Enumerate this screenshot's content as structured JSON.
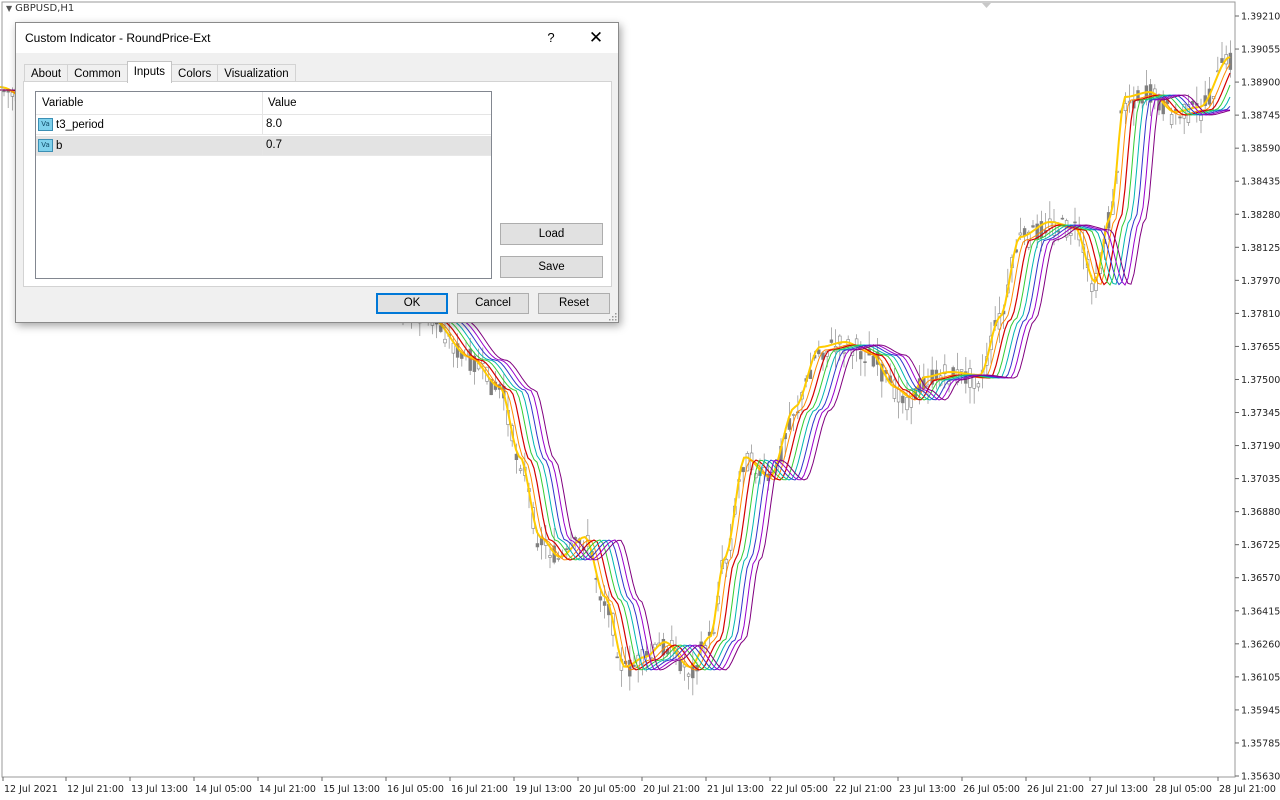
{
  "chart": {
    "symbol_label": "GBPUSD,H1",
    "y_labels": [
      "1.39210",
      "1.39055",
      "1.38900",
      "1.38745",
      "1.38590",
      "1.38435",
      "1.38280",
      "1.38125",
      "1.37970",
      "1.37810",
      "1.37655",
      "1.37500",
      "1.37345",
      "1.37190",
      "1.37035",
      "1.36880",
      "1.36725",
      "1.36570",
      "1.36415",
      "1.36260",
      "1.36105",
      "1.35945",
      "1.35785",
      "1.35630"
    ],
    "x_labels": [
      "12 Jul 2021",
      "12 Jul 21:00",
      "13 Jul 13:00",
      "14 Jul 05:00",
      "14 Jul 21:00",
      "15 Jul 13:00",
      "16 Jul 05:00",
      "16 Jul 21:00",
      "19 Jul 13:00",
      "20 Jul 05:00",
      "20 Jul 21:00",
      "21 Jul 13:00",
      "22 Jul 05:00",
      "22 Jul 21:00",
      "23 Jul 13:00",
      "26 Jul 05:00",
      "26 Jul 21:00",
      "27 Jul 13:00",
      "28 Jul 05:00",
      "28 Jul 21:00"
    ],
    "colors": {
      "candle": "#7f7f7f",
      "bands": [
        "#ffcc00",
        "#ff8c00",
        "#d40000",
        "#33cc33",
        "#00b3b3",
        "#3333cc",
        "#9900cc",
        "#800080"
      ]
    }
  },
  "dialog": {
    "title": "Custom Indicator - RoundPrice-Ext",
    "help_label": "?",
    "close_label": "✕",
    "tabs": [
      "About",
      "Common",
      "Inputs",
      "Colors",
      "Visualization"
    ],
    "active_tab": "Inputs",
    "grid": {
      "headers": {
        "variable": "Variable",
        "value": "Value"
      },
      "rows": [
        {
          "icon": "Va",
          "variable": "t3_period",
          "value": "8.0"
        },
        {
          "icon": "Va",
          "variable": "b",
          "value": "0.7"
        }
      ]
    },
    "buttons": {
      "load": "Load",
      "save": "Save",
      "ok": "OK",
      "cancel": "Cancel",
      "reset": "Reset"
    }
  }
}
